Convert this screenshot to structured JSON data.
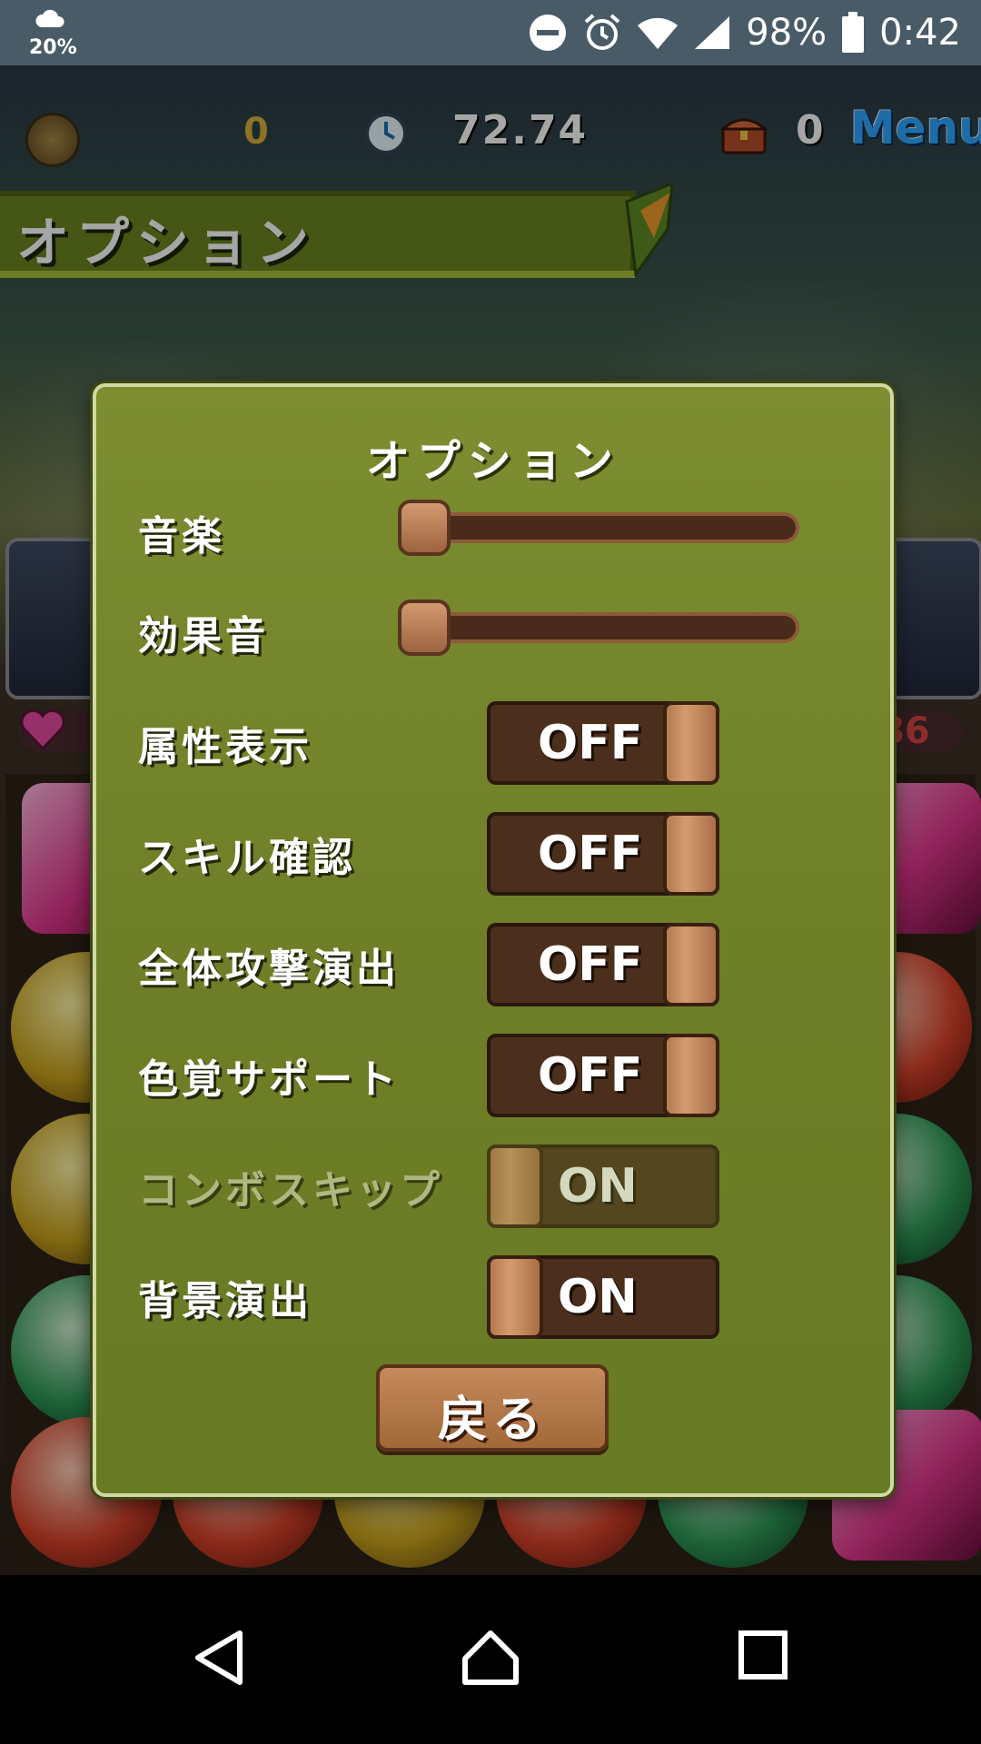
{
  "status_bar": {
    "weather_percent": "20%",
    "battery": "98%",
    "time": "0:42",
    "icons": [
      "cloud-icon",
      "do-not-disturb-icon",
      "alarm-icon",
      "wifi-icon",
      "signal-icon",
      "battery-icon"
    ]
  },
  "hud": {
    "coins": "0",
    "timer": "72.74",
    "chests": "0",
    "menu_label": "Menu"
  },
  "banner": {
    "title": "オプション"
  },
  "dialog": {
    "title": "オプション",
    "sliders": [
      {
        "label": "音楽",
        "level_percent": 0
      },
      {
        "label": "効果音",
        "level_percent": 0
      }
    ],
    "toggles": [
      {
        "label": "属性表示",
        "state": "OFF",
        "enabled": true
      },
      {
        "label": "スキル確認",
        "state": "OFF",
        "enabled": true
      },
      {
        "label": "全体攻撃演出",
        "state": "OFF",
        "enabled": true
      },
      {
        "label": "色覚サポート",
        "state": "OFF",
        "enabled": true
      },
      {
        "label": "コンボスキップ",
        "state": "ON",
        "enabled": false
      },
      {
        "label": "背景演出",
        "state": "ON",
        "enabled": true
      }
    ],
    "back_label": "戻る"
  },
  "background_hp_value": "86",
  "colors": {
    "dialog_green": "#6f7f28",
    "toggle_brown": "#4b2f1c",
    "knob_tan": "#d59b6f",
    "menu_blue": "#2fa7ff",
    "status_bar": "#4a5b68"
  }
}
